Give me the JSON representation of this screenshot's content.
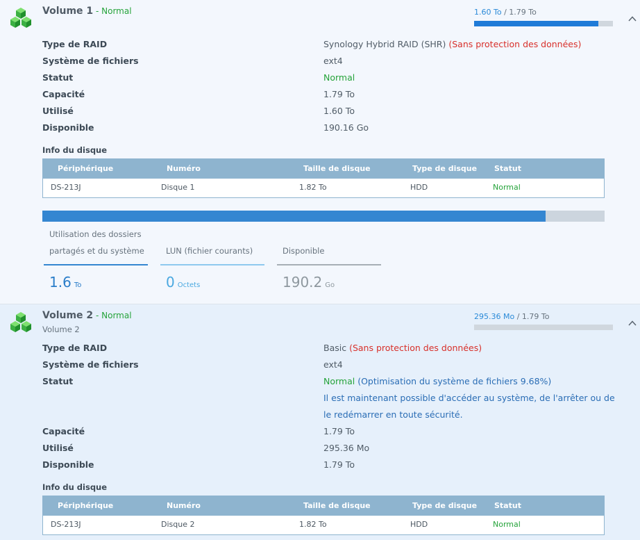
{
  "volumes": [
    {
      "title": "Volume 1",
      "status_sep": " - ",
      "status": "Normal",
      "subtitle": "",
      "usage": {
        "used": "1.60 To",
        "sep": " / ",
        "total": "1.79 To",
        "fraction": 0.894
      },
      "props": {
        "raid_label": "Type de RAID",
        "raid_value": "Synology Hybrid RAID (SHR)",
        "raid_note": "(Sans protection des données)",
        "fs_label": "Système de fichiers",
        "fs_value": "ext4",
        "status_label": "Statut",
        "status_value": "Normal",
        "capacity_label": "Capacité",
        "capacity_value": "1.79 To",
        "used_label": "Utilisé",
        "used_value": "1.60 To",
        "avail_label": "Disponible",
        "avail_value": "190.16 Go"
      },
      "disk_info_title": "Info du disque",
      "disk_table": {
        "headers": [
          "Périphérique",
          "Numéro",
          "Taille de disque",
          "Type de disque",
          "Statut"
        ],
        "rows": [
          [
            "DS-213J",
            "Disque 1",
            "1.82 To",
            "HDD",
            "Normal"
          ]
        ]
      },
      "breakdown": {
        "fill_fraction": 0.895,
        "shared_label_1": "Utilisation des dossiers",
        "shared_label_2": "partagés et du système",
        "shared_value": "1.6",
        "shared_unit": "To",
        "lun_label": "LUN (fichier courants)",
        "lun_value": "0",
        "lun_unit": "Octets",
        "avail_label": "Disponible",
        "avail_value": "190.2",
        "avail_unit": "Go"
      }
    },
    {
      "title": "Volume 2",
      "status_sep": " - ",
      "status": "Normal",
      "subtitle": "Volume 2",
      "usage": {
        "used": "295.36 Mo",
        "sep": " / ",
        "total": "1.79 To",
        "fraction": 0.0
      },
      "props": {
        "raid_label": "Type de RAID",
        "raid_value": "Basic",
        "raid_note": "(Sans protection des données)",
        "fs_label": "Système de fichiers",
        "fs_value": "ext4",
        "status_label": "Statut",
        "status_value": "Normal",
        "status_extra": "(Optimisation du système de fichiers 9.68%)",
        "status_msg_1": "Il est maintenant possible d'accéder au système, de l'arrêter ou de",
        "status_msg_2": "le redémarrer en toute sécurité.",
        "capacity_label": "Capacité",
        "capacity_value": "1.79 To",
        "used_label": "Utilisé",
        "used_value": "295.36 Mo",
        "avail_label": "Disponible",
        "avail_value": "1.79 To"
      },
      "disk_info_title": "Info du disque",
      "disk_table": {
        "headers": [
          "Périphérique",
          "Numéro",
          "Taille de disque",
          "Type de disque",
          "Statut"
        ],
        "rows": [
          [
            "DS-213J",
            "Disque 2",
            "1.82 To",
            "HDD",
            "Normal"
          ]
        ]
      }
    }
  ],
  "icons": {
    "volume": "volume-cubes-icon",
    "collapse": "chevron-up-icon"
  },
  "colors": {
    "accent": "#1f7bd8",
    "normal": "#25a33a",
    "warning": "#d8302a",
    "table_header": "#8eb4cf",
    "lun": "#4aa8e0",
    "available": "#8e989f"
  }
}
